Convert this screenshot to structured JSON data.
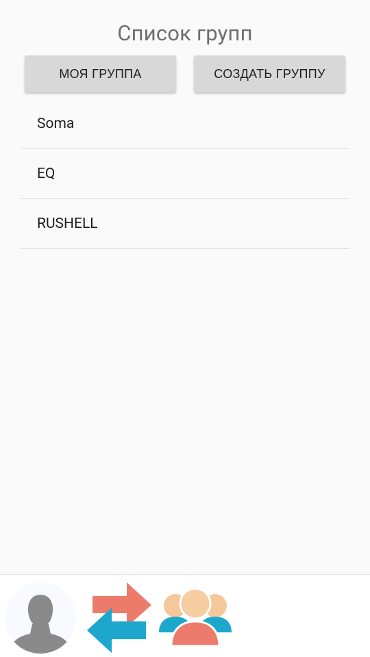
{
  "header": {
    "title": "Список групп"
  },
  "actions": {
    "my_group_label": "МОЯ ГРУППА",
    "create_group_label": "СОЗДАТЬ ГРУППУ"
  },
  "groups": [
    {
      "name": "Soma"
    },
    {
      "name": "EQ"
    },
    {
      "name": "RUSHELL"
    }
  ],
  "bottom_nav": {
    "items": [
      {
        "icon": "profile-avatar-icon"
      },
      {
        "icon": "exchange-arrows-icon"
      },
      {
        "icon": "groups-icon"
      }
    ]
  },
  "colors": {
    "background": "#fafafa",
    "button": "#d8d8d8",
    "arrow_red": "#ec7b6c",
    "arrow_blue": "#1ea7cc",
    "avatar_gray": "#8a8a8a",
    "group_skin": "#f7cda2",
    "group_red": "#ec7b6c",
    "group_blue": "#1ea7cc"
  }
}
